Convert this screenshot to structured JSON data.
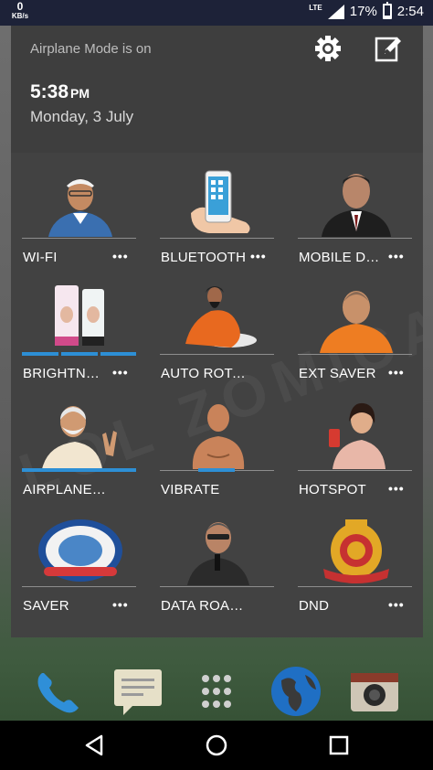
{
  "status_bar": {
    "net_speed_value": "0",
    "net_speed_unit": "KB/s",
    "network_type": "LTE",
    "battery_percent": "17%",
    "battery_level": 0.17,
    "time": "2:54"
  },
  "header": {
    "airplane_notice": "Airplane Mode is on",
    "clock_time": "5:38",
    "clock_ampm": "PM",
    "date": "Monday, 3 July",
    "settings_icon": "gear-icon",
    "edit_icon": "pencil-edit-icon"
  },
  "tiles": [
    {
      "label": "WI-FI",
      "more": "•••",
      "icon": "man-with-cap-photo"
    },
    {
      "label": "BLUETOOTH",
      "more": "•••",
      "icon": "hand-holding-phone-photo"
    },
    {
      "label": "MOBILE DA...",
      "more": "•••",
      "icon": "man-in-suit-photo"
    },
    {
      "label": "BRIGHTNESS",
      "more": "•••",
      "icon": "cream-tubes-photo"
    },
    {
      "label": "AUTO ROTATE",
      "more": "",
      "icon": "yoga-guru-photo"
    },
    {
      "label": "EXT SAVER",
      "more": "•••",
      "icon": "monk-photo"
    },
    {
      "label": "AIRPLANE MODE",
      "more": "",
      "icon": "man-victory-sign-photo"
    },
    {
      "label": "VIBRATE",
      "more": "",
      "icon": "muscular-man-photo"
    },
    {
      "label": "HOTSPOT",
      "more": "•••",
      "icon": "woman-with-phone-photo"
    },
    {
      "label": "SAVER",
      "more": "•••",
      "icon": "round-emblem-photo"
    },
    {
      "label": "DATA ROAMING",
      "more": "",
      "icon": "man-with-microphone-photo"
    },
    {
      "label": "DND",
      "more": "•••",
      "icon": "police-badge-photo"
    }
  ],
  "watermark_text": "LOL ZOMICAL ZOM",
  "dock": [
    "phone-icon",
    "messages-icon",
    "app-drawer-icon",
    "browser-globe-icon",
    "camera-icon"
  ],
  "nav": [
    "back-icon",
    "home-icon",
    "recents-icon"
  ],
  "colors": {
    "accent": "#2d8fd5",
    "panel": "#424242",
    "header_panel": "#3e3e3e",
    "status_bar": "#1d2238"
  }
}
